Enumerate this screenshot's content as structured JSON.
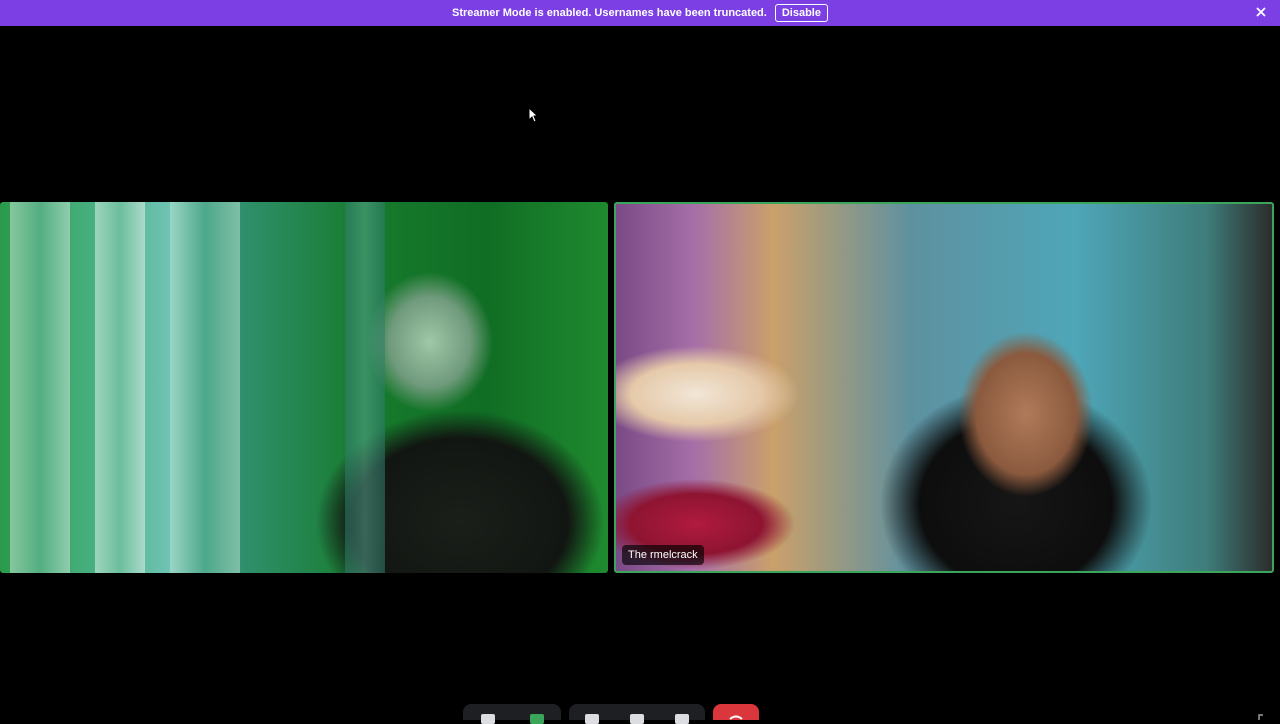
{
  "banner": {
    "message": "Streamer Mode is enabled. Usernames have been truncated.",
    "disable_label": "Disable",
    "close_icon": "close-icon",
    "color": "#7b3fe4"
  },
  "participants": [
    {
      "name": "",
      "speaking": false
    },
    {
      "name": "The rmelcrack",
      "speaking": true
    }
  ],
  "controls": {
    "icons": [
      "microphone-icon",
      "camera-icon",
      "screen-share-icon",
      "activity-icon",
      "soundboard-icon",
      "end-call-icon"
    ],
    "end_call_color": "#da373c",
    "speaking_border_color": "#3ba55c"
  }
}
